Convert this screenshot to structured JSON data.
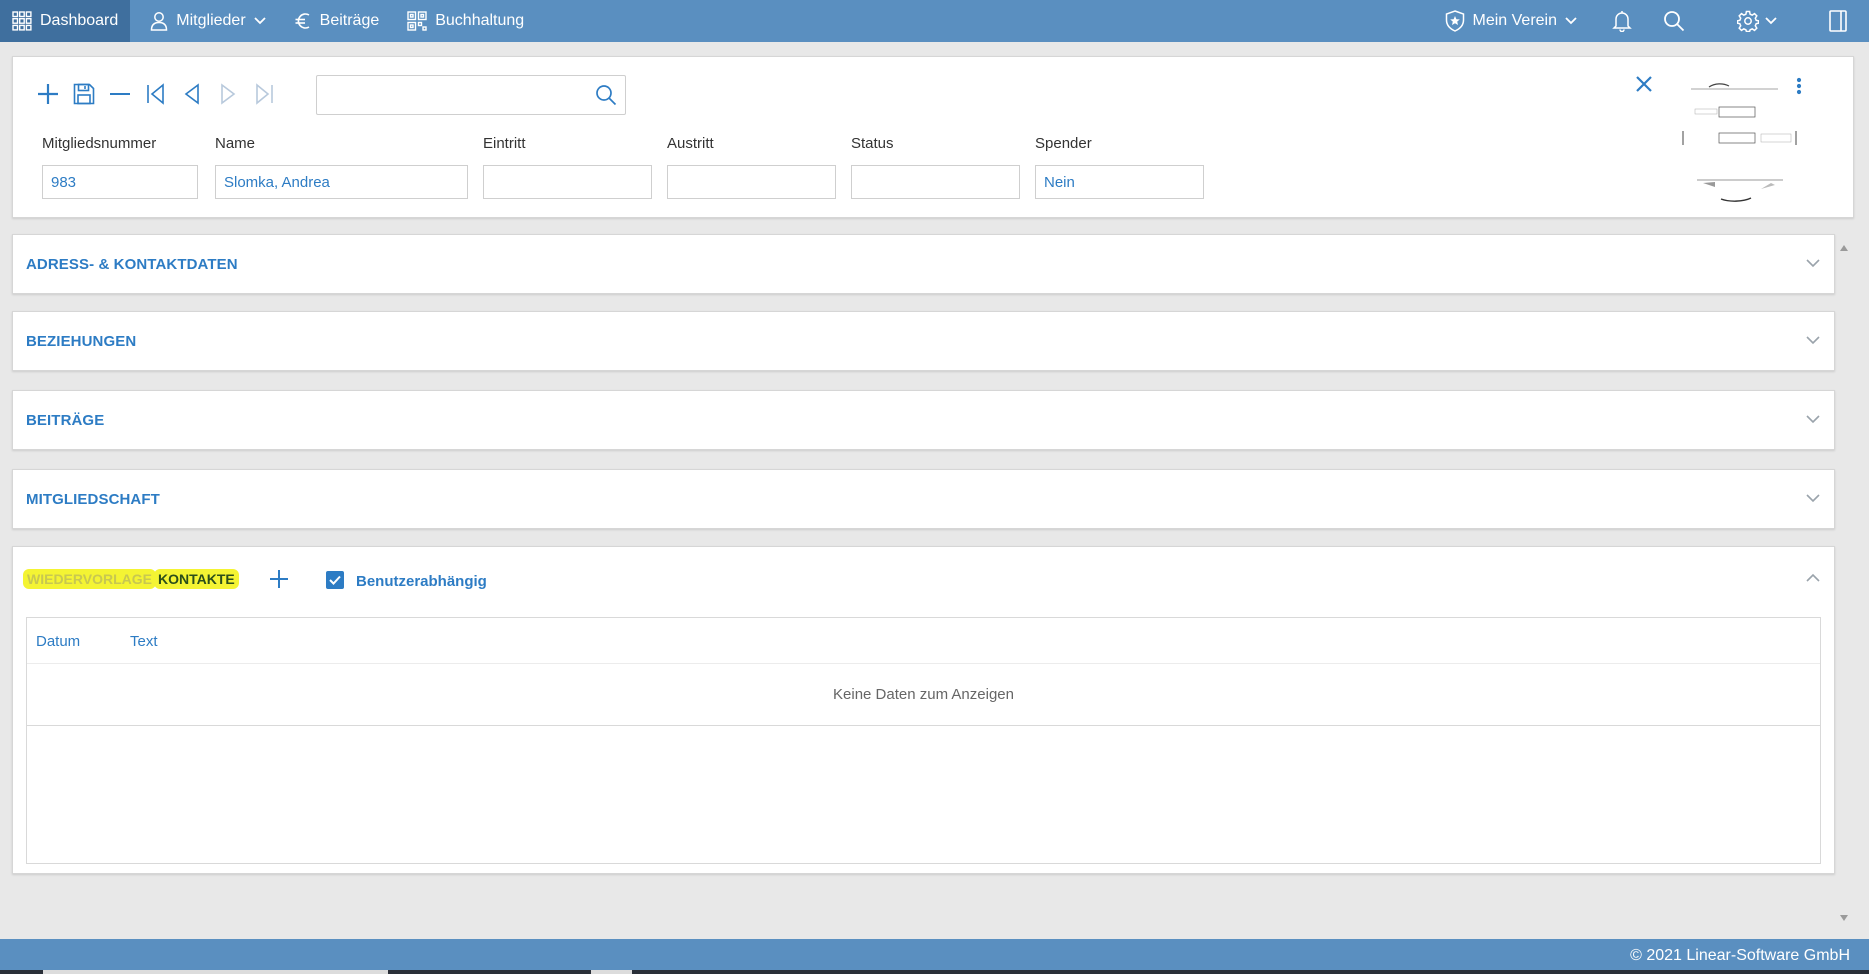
{
  "nav": {
    "dashboard": "Dashboard",
    "members": "Mitglieder",
    "fees": "Beiträge",
    "accounting": "Buchhaltung",
    "club": "Mein Verein"
  },
  "search": {
    "value": "",
    "placeholder": ""
  },
  "fields": {
    "member_number": {
      "label": "Mitgliedsnummer",
      "value": "983"
    },
    "name": {
      "label": "Name",
      "value": "Slomka, Andrea"
    },
    "entry": {
      "label": "Eintritt",
      "value": ""
    },
    "exit": {
      "label": "Austritt",
      "value": ""
    },
    "status": {
      "label": "Status",
      "value": ""
    },
    "donor": {
      "label": "Spender",
      "value": "Nein"
    }
  },
  "sections": {
    "address": "ADRESS- & KONTAKTDATEN",
    "relations": "BEZIEHUNGEN",
    "fees": "BEITRÄGE",
    "membership": "MITGLIEDSCHAFT"
  },
  "open_section": {
    "tab_followup": "WIEDERVORLAGE",
    "tab_contacts": "KONTAKTE",
    "checkbox_label": "Benutzerabhängig",
    "checkbox_checked": true,
    "columns": [
      "Datum",
      "Text"
    ],
    "empty_text": "Keine Daten zum Anzeigen"
  },
  "footer": {
    "copyright": "© 2021 Linear-Software GmbH"
  },
  "colors": {
    "nav_bg": "#5a8fc0",
    "nav_active": "#3f6f9e",
    "accent": "#2d7cc4",
    "highlight": "#f4f433"
  }
}
